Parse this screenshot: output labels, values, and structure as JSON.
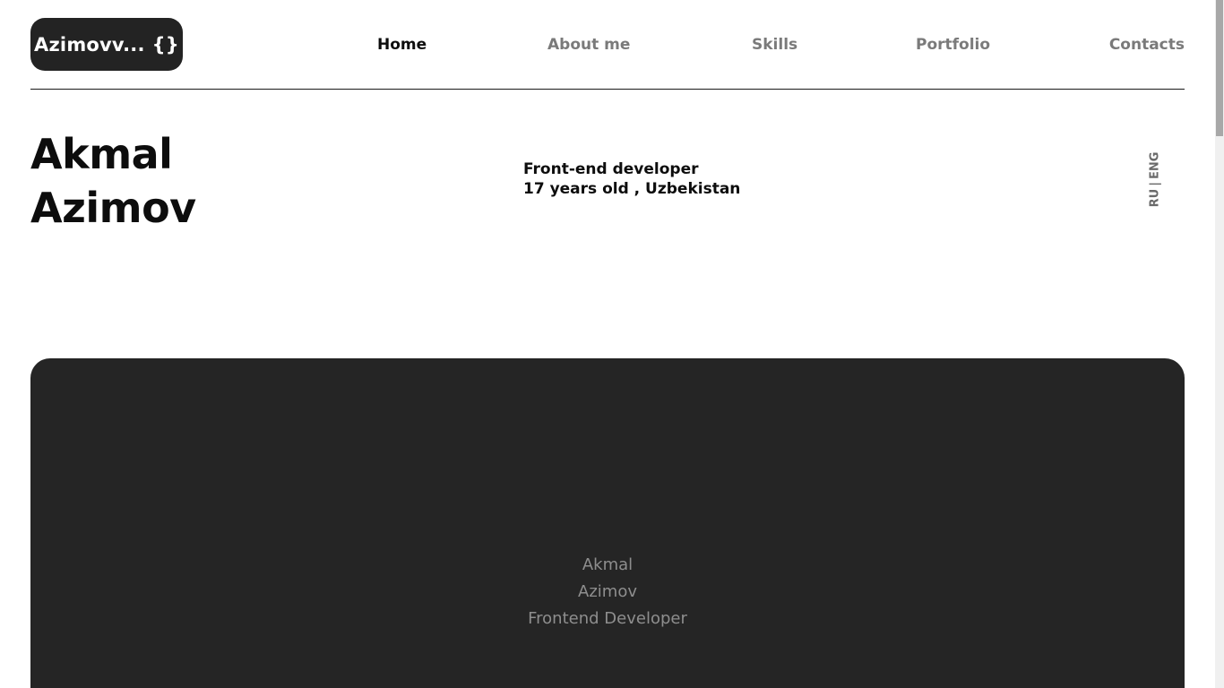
{
  "header": {
    "logo_text": "Azimovv...",
    "logo_braces": "{}",
    "nav": {
      "home": "Home",
      "about": "About me",
      "skills": "Skills",
      "portfolio": "Portfolio",
      "contacts": "Contacts"
    },
    "active_nav": "Home"
  },
  "hero": {
    "first_name": "Akmal",
    "last_name": "Azimov",
    "role": "Front-end developer",
    "details": "17 years old , Uzbekistan",
    "lang": {
      "ru": "RU",
      "separator": "|",
      "eng": "ENG"
    }
  },
  "card": {
    "line1": "Akmal",
    "line2": "Azimov",
    "line3": "Frontend Developer"
  },
  "colors": {
    "accent_dark": "#232323",
    "card_bg": "#252525",
    "nav_inactive": "#7a7a7a",
    "text": "#0d0d0d"
  }
}
